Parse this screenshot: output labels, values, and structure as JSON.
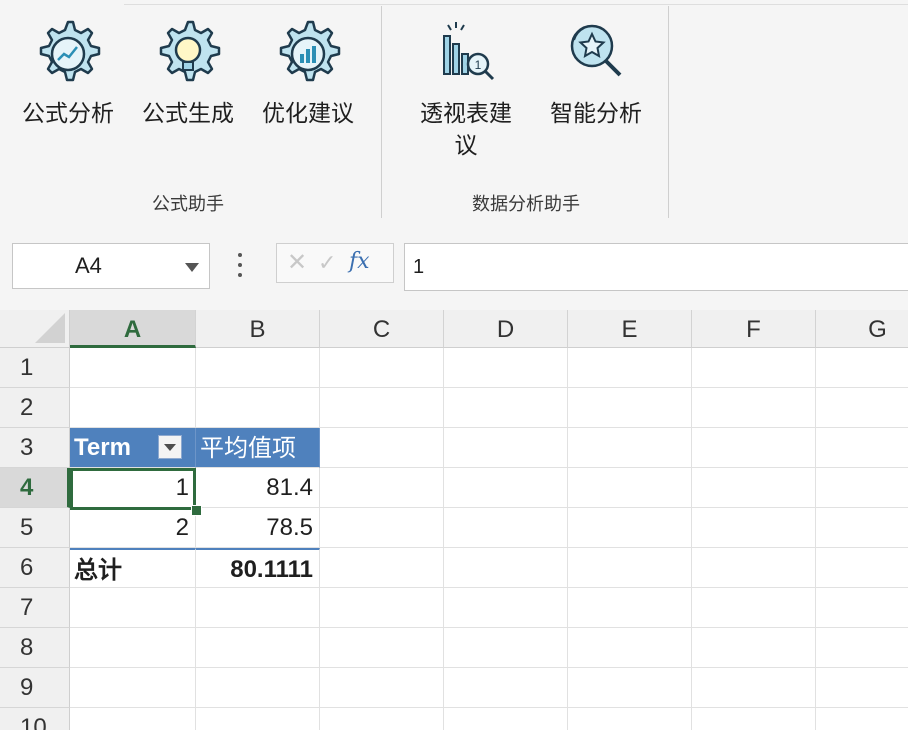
{
  "ribbon": {
    "groups": [
      {
        "label": "公式助手",
        "buttons": [
          {
            "label": "公式分析",
            "icon": "formula-analysis-gear-icon"
          },
          {
            "label": "公式生成",
            "icon": "formula-generate-bulb-gear-icon"
          },
          {
            "label": "优化建议",
            "icon": "optimize-suggestion-gear-icon"
          }
        ]
      },
      {
        "label": "数据分析助手",
        "buttons": [
          {
            "label": "透视表建议",
            "icon": "pivot-suggestion-icon"
          },
          {
            "label": "智能分析",
            "icon": "smart-analysis-icon"
          }
        ]
      }
    ]
  },
  "formula_bar": {
    "name_box": "A4",
    "cancel_symbol": "✕",
    "confirm_symbol": "✓",
    "fx_label": "fx",
    "value": "1"
  },
  "sheet": {
    "columns": [
      "A",
      "B",
      "C",
      "D",
      "E",
      "F",
      "G"
    ],
    "rows": [
      "1",
      "2",
      "3",
      "4",
      "5",
      "6",
      "7",
      "8",
      "9",
      "10"
    ],
    "selected_cell": "A4",
    "pivot": {
      "row_field": "Term",
      "value_field": "平均值项",
      "rows": [
        {
          "term": "1",
          "value": "81.4"
        },
        {
          "term": "2",
          "value": "78.5"
        }
      ],
      "total_label": "总计",
      "total_value": "80.1111"
    }
  },
  "colors": {
    "accent_green": "#2e8b3e",
    "selection_green": "#2f6b3e",
    "pivot_header_blue": "#4f81bd",
    "icon_blue": "#4aa7c8"
  }
}
